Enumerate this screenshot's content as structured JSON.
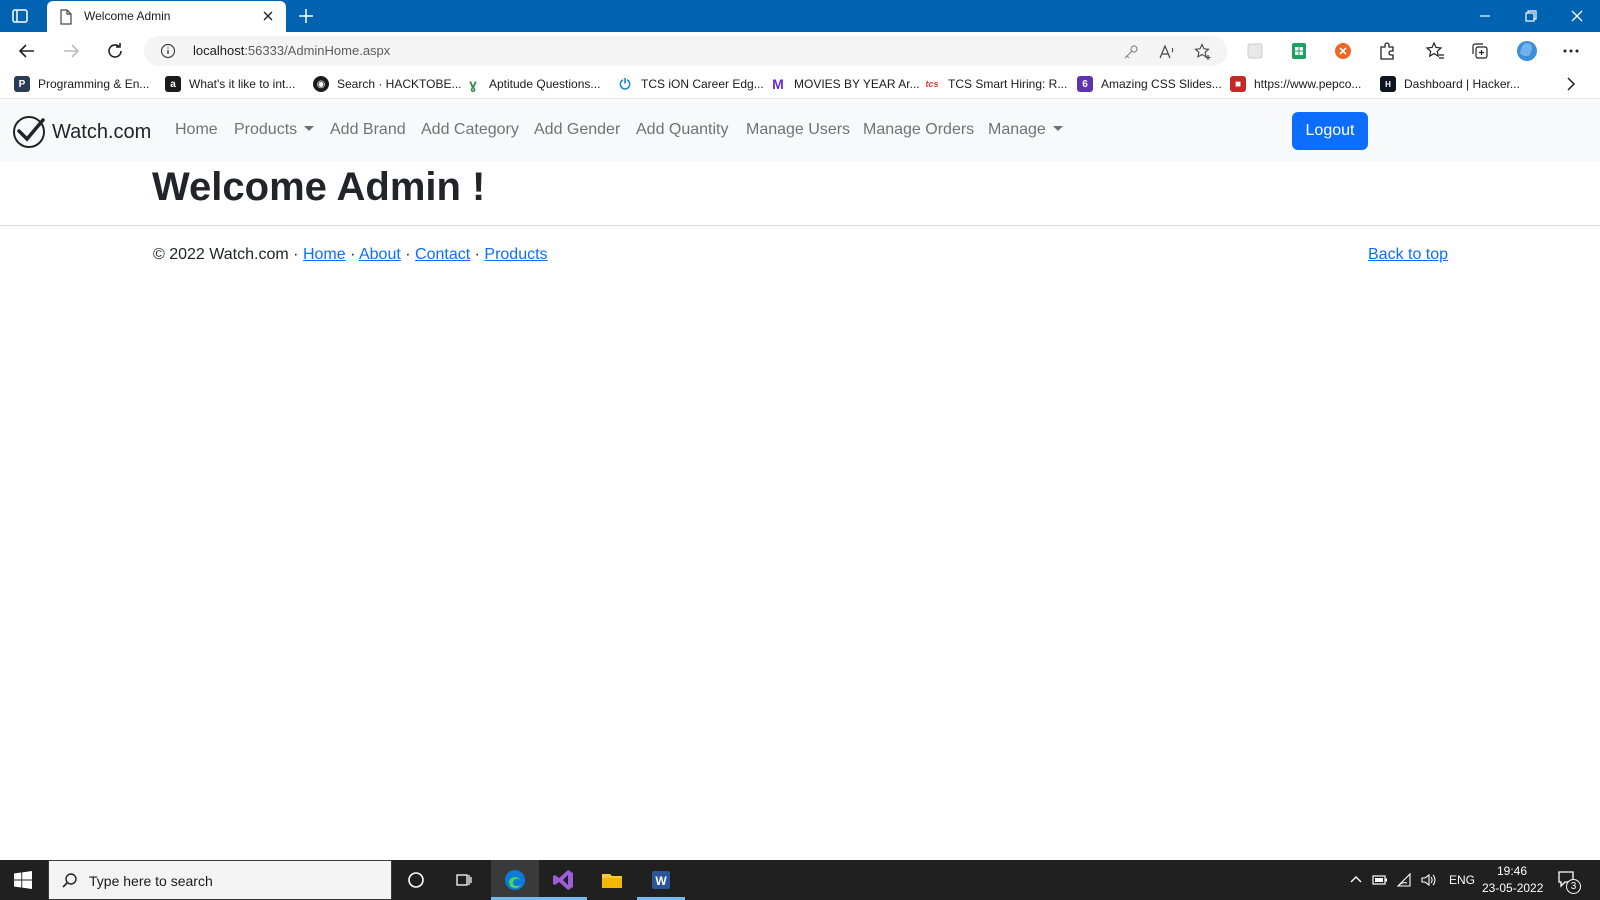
{
  "browser": {
    "tab_title": "Welcome Admin",
    "url_host": "localhost",
    "url_path": ":56333/AdminHome.aspx",
    "accent": "#0063b1",
    "bookmarks": [
      {
        "label": "Programming & En...",
        "icon": "programming-favicon",
        "color": "#2b3a55"
      },
      {
        "label": "What's it like to int...",
        "icon": "amazon-favicon",
        "color": "#1b1b1b"
      },
      {
        "label": "Search · HACKTOBE...",
        "icon": "github-favicon",
        "color": "#1b1b1b"
      },
      {
        "label": "Aptitude Questions...",
        "icon": "geeks-favicon",
        "color": "#2f8d46"
      },
      {
        "label": "TCS iON Career Edg...",
        "icon": "power-favicon",
        "color": "#1e88e5"
      },
      {
        "label": "MOVIES BY YEAR Ar...",
        "icon": "m-favicon",
        "color": "#6a2bd9"
      },
      {
        "label": "TCS Smart Hiring: R...",
        "icon": "tcs-favicon",
        "color": "#e53935"
      },
      {
        "label": "Amazing CSS Slides...",
        "icon": "six-favicon",
        "color": "#5e35b1"
      },
      {
        "label": "https://www.pepco...",
        "icon": "cube-favicon",
        "color": "#c62828"
      },
      {
        "label": "Dashboard | Hacker...",
        "icon": "hackerrank-favicon",
        "color": "#0e141e"
      }
    ]
  },
  "site": {
    "brand": "Watch.com",
    "nav": {
      "home": "Home",
      "products": "Products",
      "add_brand": "Add Brand",
      "add_category": "Add Category",
      "add_gender": "Add Gender",
      "add_quantity": "Add Quantity",
      "manage_users": "Manage Users",
      "manage_orders": "Manage Orders",
      "manage": "Manage"
    },
    "logout": "Logout",
    "heading": "Welcome Admin !",
    "footer": {
      "copyright": "© 2022 Watch.com",
      "sep": "·",
      "home": "Home",
      "about": "About",
      "contact": "Contact",
      "products": "Products",
      "back_to_top": "Back to top"
    },
    "primary_color": "#0d6efd"
  },
  "taskbar": {
    "search_placeholder": "Type here to search",
    "language": "ENG",
    "time": "19:46",
    "date": "23-05-2022",
    "notification_count": "3"
  }
}
